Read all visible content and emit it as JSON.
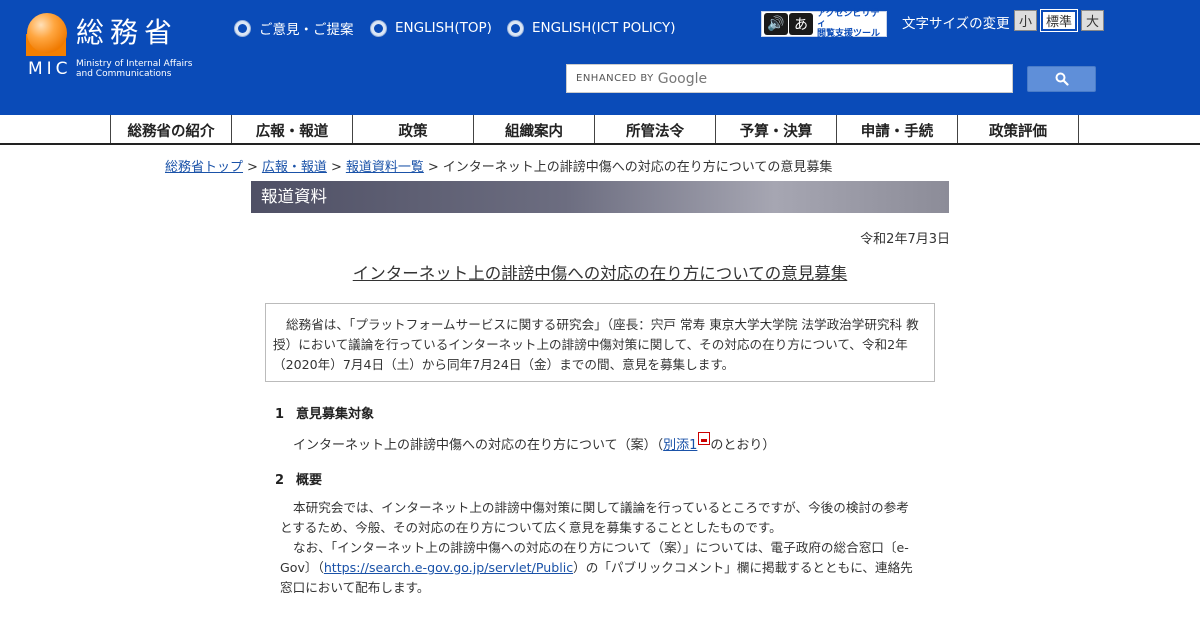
{
  "header": {
    "logo_jp": "総務省",
    "logo_mic": "MIC",
    "logo_en_line1": "Ministry of Internal Affairs",
    "logo_en_line2": "and Communications",
    "links": [
      {
        "label": "ご意見・ご提案"
      },
      {
        "label": "ENGLISH(TOP)"
      },
      {
        "label": "ENGLISH(ICT POLICY)"
      }
    ],
    "accessibility": {
      "icon1": "🔊",
      "icon2": "あ",
      "line1": "アクセシビリティ",
      "line2": "閲覧支援ツール"
    },
    "font_size_label": "文字サイズの変更",
    "font_small": "小",
    "font_standard": "標準",
    "font_large": "大",
    "search": {
      "enhanced_by": "ENHANCED BY",
      "google": "Google"
    }
  },
  "global_nav": [
    "総務省の紹介",
    "広報・報道",
    "政策",
    "組織案内",
    "所管法令",
    "予算・決算",
    "申請・手続",
    "政策評価"
  ],
  "breadcrumb": {
    "items": [
      "総務省トップ",
      "広報・報道",
      "報道資料一覧"
    ],
    "separator": ">",
    "current": "インターネット上の誹謗中傷への対応の在り方についての意見募集"
  },
  "section_title": "報道資料",
  "date": "令和2年7月3日",
  "title": "インターネット上の誹謗中傷への対応の在り方についての意見募集",
  "summary": "総務省は、「プラットフォームサービスに関する研究会」（座長：宍戸 常寿 東京大学大学院 法学政治学研究科 教授）において議論を行っているインターネット上の誹謗中傷対策に関して、その対応の在り方について、令和2年（2020年）7月4日（土）から同年7月24日（金）までの間、意見を募集します。",
  "sections": [
    {
      "num": "1",
      "heading": "意見募集対象",
      "text_before": "インターネット上の誹謗中傷への対応の在り方について（案）（",
      "link": "別添1",
      "text_after": "のとおり）"
    },
    {
      "num": "2",
      "heading": "概要",
      "para1": "本研究会では、インターネット上の誹謗中傷対策に関して議論を行っているところですが、今後の検討の参考とするため、今般、その対応の在り方について広く意見を募集することとしたものです。",
      "para2_before": "なお、「インターネット上の誹謗中傷への対応の在り方について（案）」については、電子政府の総合窓口〔e-Gov〕（",
      "para2_link": "https://search.e-gov.go.jp/servlet/Public",
      "para2_after": "）の「パブリックコメント」欄に掲載するとともに、連絡先窓口において配布します。"
    }
  ],
  "colors": {
    "header_bg": "#0a4bb8",
    "logo_orange": "#f47f00",
    "link": "#1a52a8"
  }
}
